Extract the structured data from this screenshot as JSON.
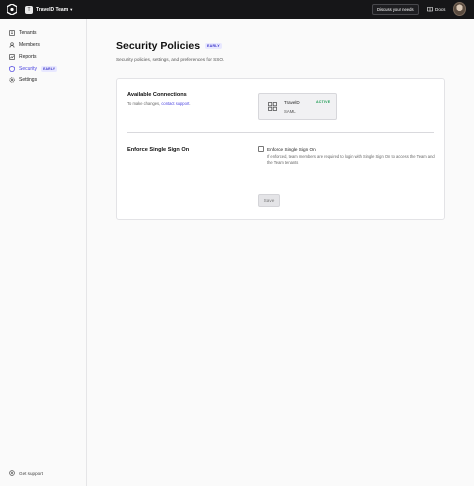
{
  "topbar": {
    "team_initial": "T",
    "team_name": "TravelD Team",
    "discuss_label": "Discuss your needs",
    "docs_label": "Docs"
  },
  "sidebar": {
    "items": [
      {
        "label": "Tenants",
        "icon": "building-icon"
      },
      {
        "label": "Members",
        "icon": "users-icon"
      },
      {
        "label": "Reports",
        "icon": "chart-icon"
      },
      {
        "label": "Security",
        "icon": "shield-icon",
        "badge": "EARLY",
        "active": true
      },
      {
        "label": "Settings",
        "icon": "gear-icon"
      }
    ],
    "support_label": "Get support"
  },
  "main": {
    "title": "Security Policies",
    "title_badge": "EARLY",
    "subtitle": "Security policies, settings, and preferences for SSO.",
    "connections": {
      "title": "Available Connections",
      "note_prefix": "To make changes, ",
      "note_link": "contact support",
      "note_suffix": ".",
      "item": {
        "name": "TravelD",
        "type": "SAML",
        "status": "ACTIVE"
      }
    },
    "enforce": {
      "title": "Enforce Single Sign On",
      "checkbox_label": "Enforce Single Sign On",
      "checked": false,
      "help": "If enforced, team members are required to login with Single Sign On to access the Team and the Team tenants"
    },
    "save_label": "Save"
  },
  "colors": {
    "accent": "#4b43e0",
    "topbar": "#161618",
    "active_status": "#1f9d55"
  }
}
